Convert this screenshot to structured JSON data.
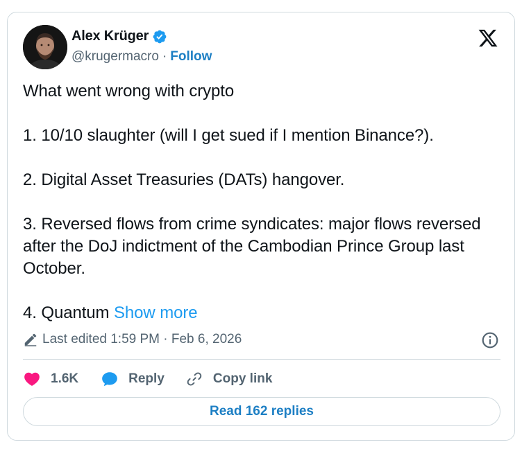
{
  "author": {
    "name": "Alex Krüger",
    "handle": "@krugermacro",
    "separator": "·",
    "follow_label": "Follow"
  },
  "tweet": {
    "line1": "What went wrong with crypto",
    "line2": "1. 10/10 slaughter (will I get sued if I mention Binance?).",
    "line3": "2. Digital Asset Treasuries (DATs) hangover.",
    "line4": "3. Reversed flows from crime syndicates: major flows reversed after the DoJ indictment of the Cambodian Prince Group last October.",
    "line5": "4. Quantum",
    "show_more": "Show more"
  },
  "edited": {
    "text": "Last edited 1:59 PM · Feb 6, 2026"
  },
  "actions": {
    "likes": "1.6K",
    "reply_label": "Reply",
    "copy_link_label": "Copy link"
  },
  "read_replies_label": "Read 162 replies",
  "icons": {
    "verified": "verified-badge-icon",
    "logo": "x-logo-icon",
    "edit": "pencil-icon",
    "info": "info-icon",
    "like": "heart-icon",
    "reply": "speech-bubble-icon",
    "link": "link-icon"
  },
  "colors": {
    "accent": "#1d9bf0",
    "follow": "#1d7fc4",
    "heart": "#f91880",
    "muted": "#536471",
    "border": "#cfd9de"
  }
}
